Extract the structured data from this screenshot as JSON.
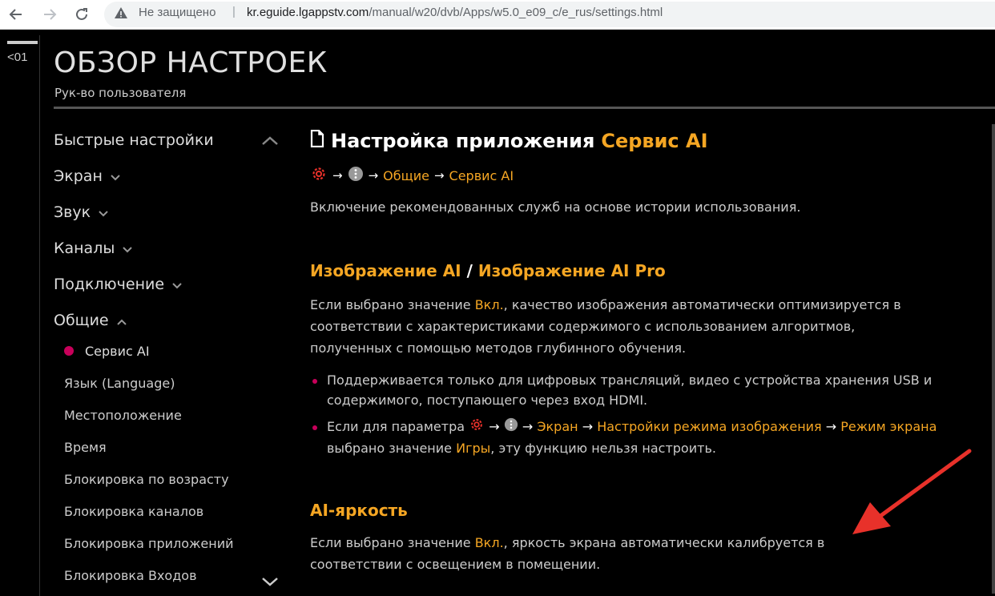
{
  "browser": {
    "not_secure": "Не защищено",
    "separator": "|",
    "url_domain": "kr.eguide.lgappstv.com",
    "url_path": "/manual/w20/dvb/Apps/w5.0_e09_c/e_rus/settings.html"
  },
  "header": {
    "back_label": "<01",
    "title": "ОБЗОР НАСТРОЕК",
    "subtitle": "Рук-во пользователя"
  },
  "sidebar": {
    "items": [
      {
        "label": "Быстрые настройки"
      },
      {
        "label": "Экран"
      },
      {
        "label": "Звук"
      },
      {
        "label": "Каналы"
      },
      {
        "label": "Подключение"
      },
      {
        "label": "Общие"
      }
    ],
    "subitems": [
      {
        "label": "Сервис AI"
      },
      {
        "label": "Язык (Language)"
      },
      {
        "label": "Местоположение"
      },
      {
        "label": "Время"
      },
      {
        "label": "Блокировка по возрасту"
      },
      {
        "label": "Блокировка каналов"
      },
      {
        "label": "Блокировка приложений"
      },
      {
        "label": "Блокировка Входов"
      }
    ]
  },
  "content": {
    "title_prefix": "Настройка приложения",
    "title_highlight": "Сервис AI",
    "path_general": "Общие",
    "path_service": "Сервис AI",
    "intro": "Включение рекомендованных служб на основе истории использования.",
    "section1": {
      "title_a": "Изображение AI",
      "title_sep": " / ",
      "title_b": "Изображение AI Pro",
      "p_before": "Если выбрано значение ",
      "p_on": "Вкл.",
      "p_after": ", качество изображения автоматически оптимизируется в соответствии с характеристиками содержимого с использованием алгоритмов, полученных с помощью методов глубинного обучения.",
      "bullet1": "Поддерживается только для цифровых трансляций, видео с устройства хранения USB и содержимого, поступающего через вход HDMI.",
      "bullet2_before": "Если для параметра",
      "bullet2_screen": "Экран",
      "bullet2_mode": "Настройки режима изображения",
      "bullet2_screenmode": "Режим экрана",
      "bullet2_selected": "выбрано значение ",
      "bullet2_games": "Игры",
      "bullet2_after": ", эту функцию нельзя настроить."
    },
    "section2": {
      "title": "AI-яркость",
      "p_before": "Если выбрано значение ",
      "p_on": "Вкл.",
      "p_after": ", яркость экрана автоматически калибруется в соответствии с освещением в помещении."
    }
  },
  "colors": {
    "accent": "#f5a623",
    "bullet": "#c8005a",
    "annotation_arrow": "#e8312a"
  },
  "icons": [
    "back-arrow-icon",
    "forward-arrow-icon",
    "reload-icon",
    "warning-icon",
    "document-icon",
    "settings-gear-icon",
    "more-dots-icon",
    "chevron-up-icon",
    "chevron-down-icon"
  ]
}
